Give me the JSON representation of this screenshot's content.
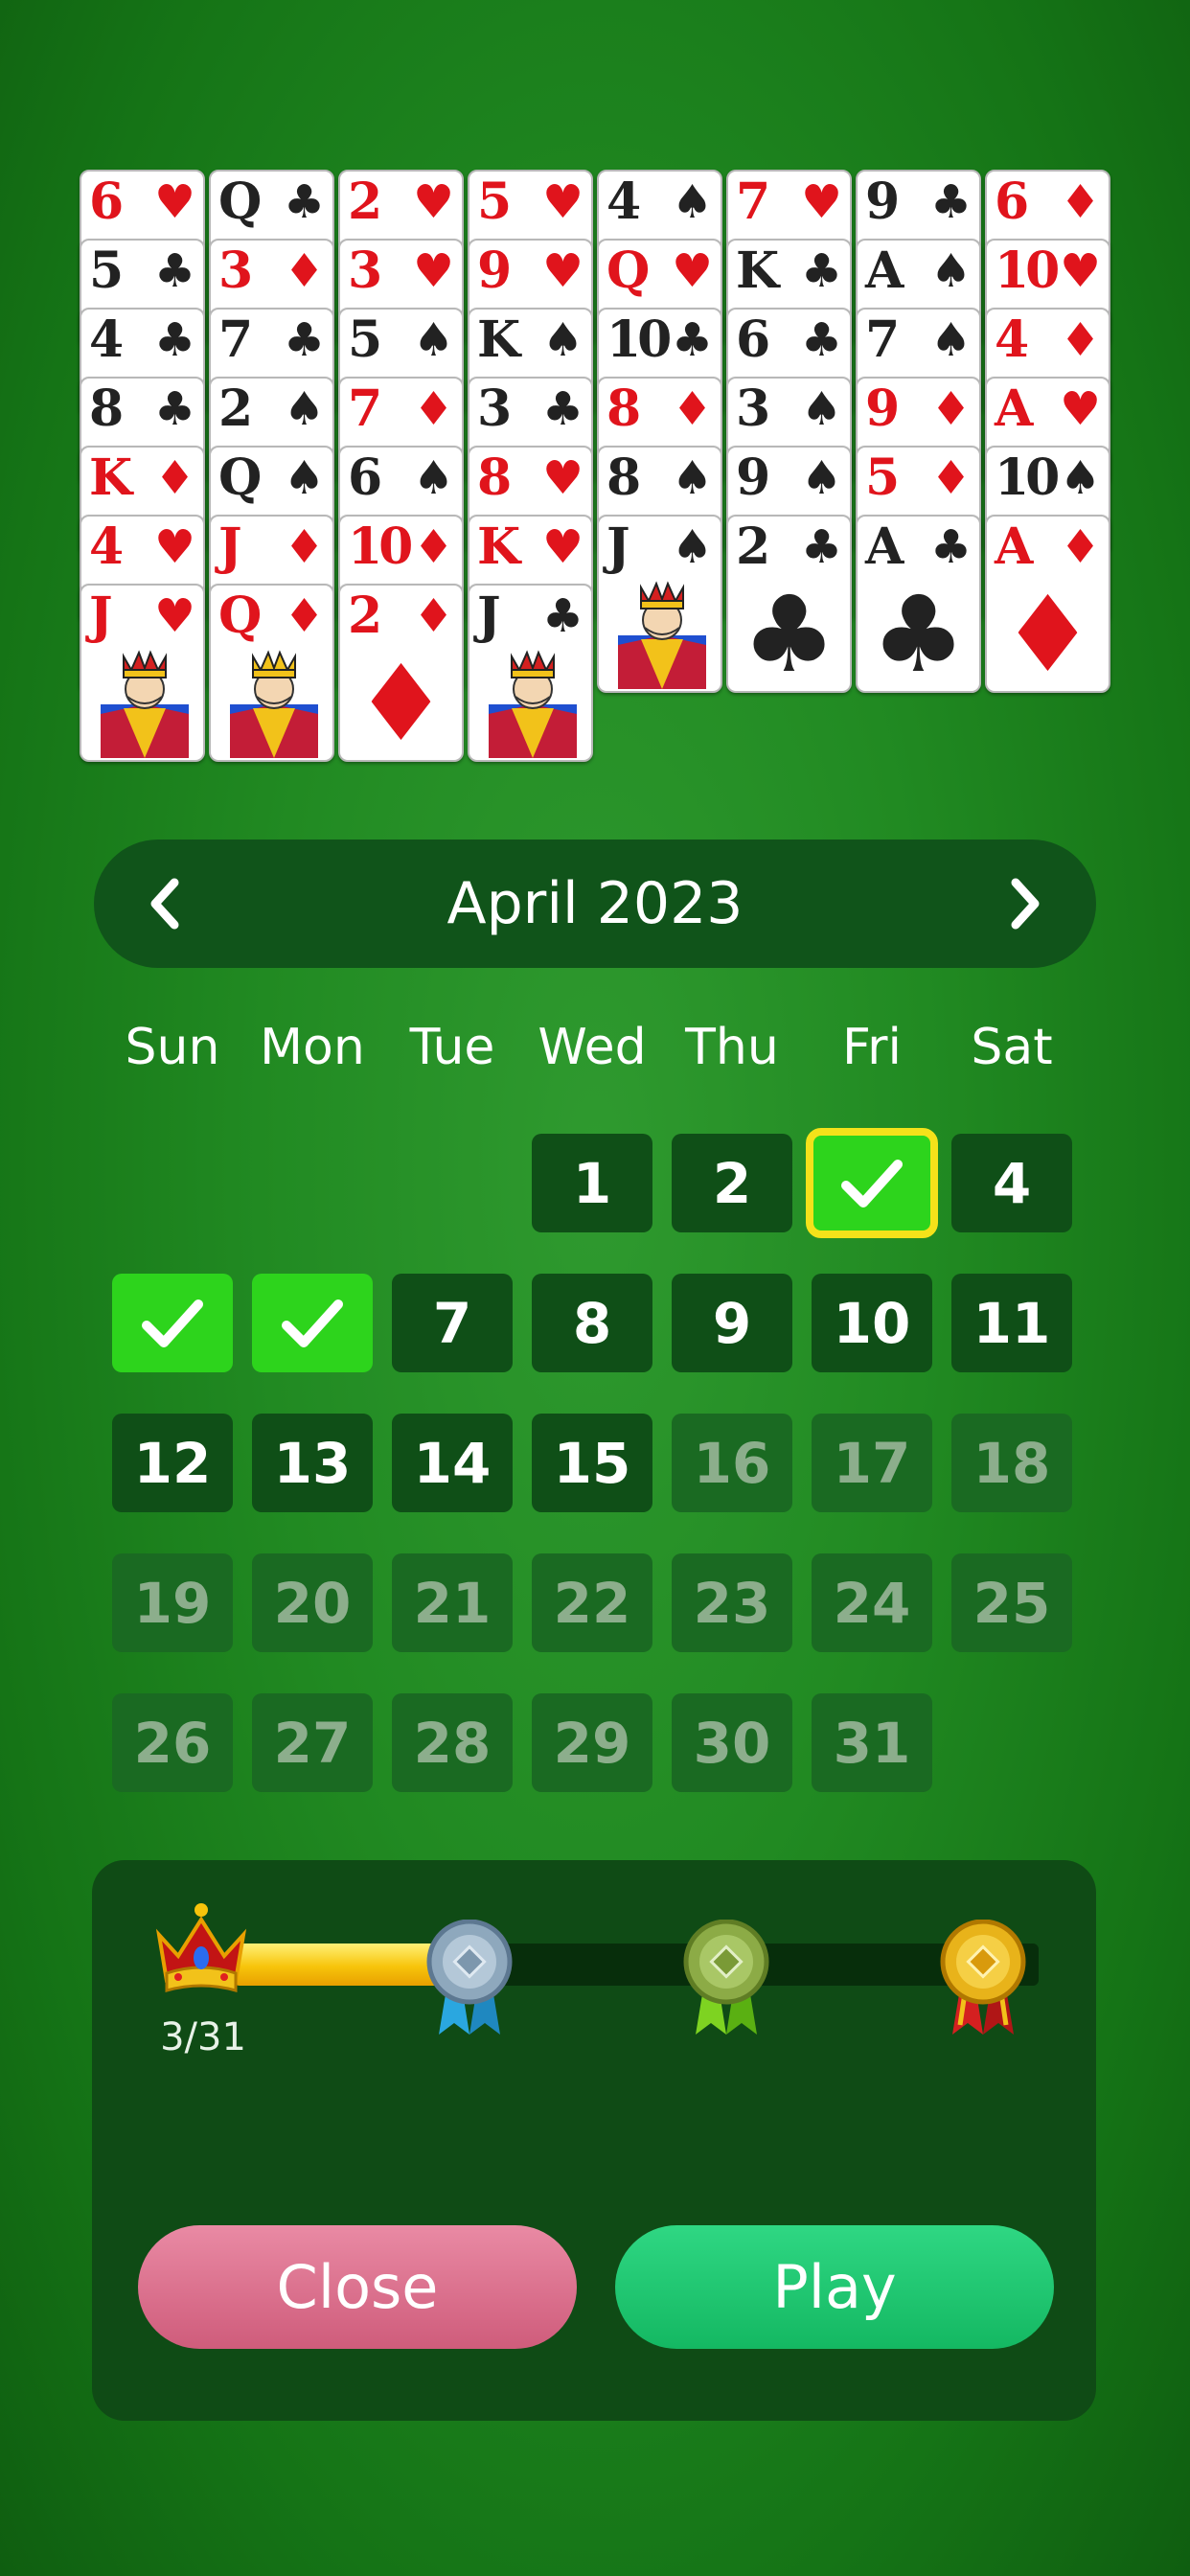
{
  "tableau": [
    [
      {
        "r": "6",
        "s": "♥",
        "c": "red"
      },
      {
        "r": "5",
        "s": "♣",
        "c": "black"
      },
      {
        "r": "4",
        "s": "♣",
        "c": "black"
      },
      {
        "r": "8",
        "s": "♣",
        "c": "black"
      },
      {
        "r": "K",
        "s": "♦",
        "c": "red"
      },
      {
        "r": "4",
        "s": "♥",
        "c": "red"
      },
      {
        "r": "J",
        "s": "♥",
        "c": "red",
        "face": "jack"
      }
    ],
    [
      {
        "r": "Q",
        "s": "♣",
        "c": "black"
      },
      {
        "r": "3",
        "s": "♦",
        "c": "red"
      },
      {
        "r": "7",
        "s": "♣",
        "c": "black"
      },
      {
        "r": "2",
        "s": "♠",
        "c": "black"
      },
      {
        "r": "Q",
        "s": "♠",
        "c": "black"
      },
      {
        "r": "J",
        "s": "♦",
        "c": "red"
      },
      {
        "r": "Q",
        "s": "♦",
        "c": "red",
        "face": "queen"
      }
    ],
    [
      {
        "r": "2",
        "s": "♥",
        "c": "red"
      },
      {
        "r": "3",
        "s": "♥",
        "c": "red"
      },
      {
        "r": "5",
        "s": "♠",
        "c": "black"
      },
      {
        "r": "7",
        "s": "♦",
        "c": "red"
      },
      {
        "r": "6",
        "s": "♠",
        "c": "black"
      },
      {
        "r": "10",
        "s": "♦",
        "c": "red"
      },
      {
        "r": "2",
        "s": "♦",
        "c": "red"
      }
    ],
    [
      {
        "r": "5",
        "s": "♥",
        "c": "red"
      },
      {
        "r": "9",
        "s": "♥",
        "c": "red"
      },
      {
        "r": "K",
        "s": "♠",
        "c": "black"
      },
      {
        "r": "3",
        "s": "♣",
        "c": "black"
      },
      {
        "r": "8",
        "s": "♥",
        "c": "red"
      },
      {
        "r": "K",
        "s": "♥",
        "c": "red"
      },
      {
        "r": "J",
        "s": "♣",
        "c": "black",
        "face": "jack"
      }
    ],
    [
      {
        "r": "4",
        "s": "♠",
        "c": "black"
      },
      {
        "r": "Q",
        "s": "♥",
        "c": "red"
      },
      {
        "r": "10",
        "s": "♣",
        "c": "black"
      },
      {
        "r": "8",
        "s": "♦",
        "c": "red"
      },
      {
        "r": "8",
        "s": "♠",
        "c": "black"
      },
      {
        "r": "J",
        "s": "♠",
        "c": "black",
        "face": "jack"
      }
    ],
    [
      {
        "r": "7",
        "s": "♥",
        "c": "red"
      },
      {
        "r": "K",
        "s": "♣",
        "c": "black"
      },
      {
        "r": "6",
        "s": "♣",
        "c": "black"
      },
      {
        "r": "3",
        "s": "♠",
        "c": "black"
      },
      {
        "r": "9",
        "s": "♠",
        "c": "black"
      },
      {
        "r": "2",
        "s": "♣",
        "c": "black"
      }
    ],
    [
      {
        "r": "9",
        "s": "♣",
        "c": "black"
      },
      {
        "r": "A",
        "s": "♠",
        "c": "black"
      },
      {
        "r": "7",
        "s": "♠",
        "c": "black"
      },
      {
        "r": "9",
        "s": "♦",
        "c": "red"
      },
      {
        "r": "5",
        "s": "♦",
        "c": "red"
      },
      {
        "r": "A",
        "s": "♣",
        "c": "black"
      }
    ],
    [
      {
        "r": "6",
        "s": "♦",
        "c": "red"
      },
      {
        "r": "10",
        "s": "♥",
        "c": "red"
      },
      {
        "r": "4",
        "s": "♦",
        "c": "red"
      },
      {
        "r": "A",
        "s": "♥",
        "c": "red"
      },
      {
        "r": "10",
        "s": "♠",
        "c": "black"
      },
      {
        "r": "A",
        "s": "♦",
        "c": "red"
      }
    ]
  ],
  "calendar": {
    "month_label": "April 2023",
    "weekdays": [
      "Sun",
      "Mon",
      "Tue",
      "Wed",
      "Thu",
      "Fri",
      "Sat"
    ],
    "first_weekday_index": 3,
    "days_in_month": 31,
    "completed_days": [
      3,
      5,
      6
    ],
    "selected_day": 3,
    "last_available_day": 15
  },
  "progress": {
    "label": "3/31",
    "completed": 3,
    "total": 31,
    "medals": [
      "crown-icon",
      "silver-medal-icon",
      "green-medal-icon",
      "gold-medal-icon"
    ]
  },
  "buttons": {
    "close_label": "Close",
    "play_label": "Play"
  },
  "colors": {
    "completed": "#2dd41c",
    "selected_outline": "#f4e21a",
    "close": "#d96a89",
    "play": "#1fc56f"
  }
}
